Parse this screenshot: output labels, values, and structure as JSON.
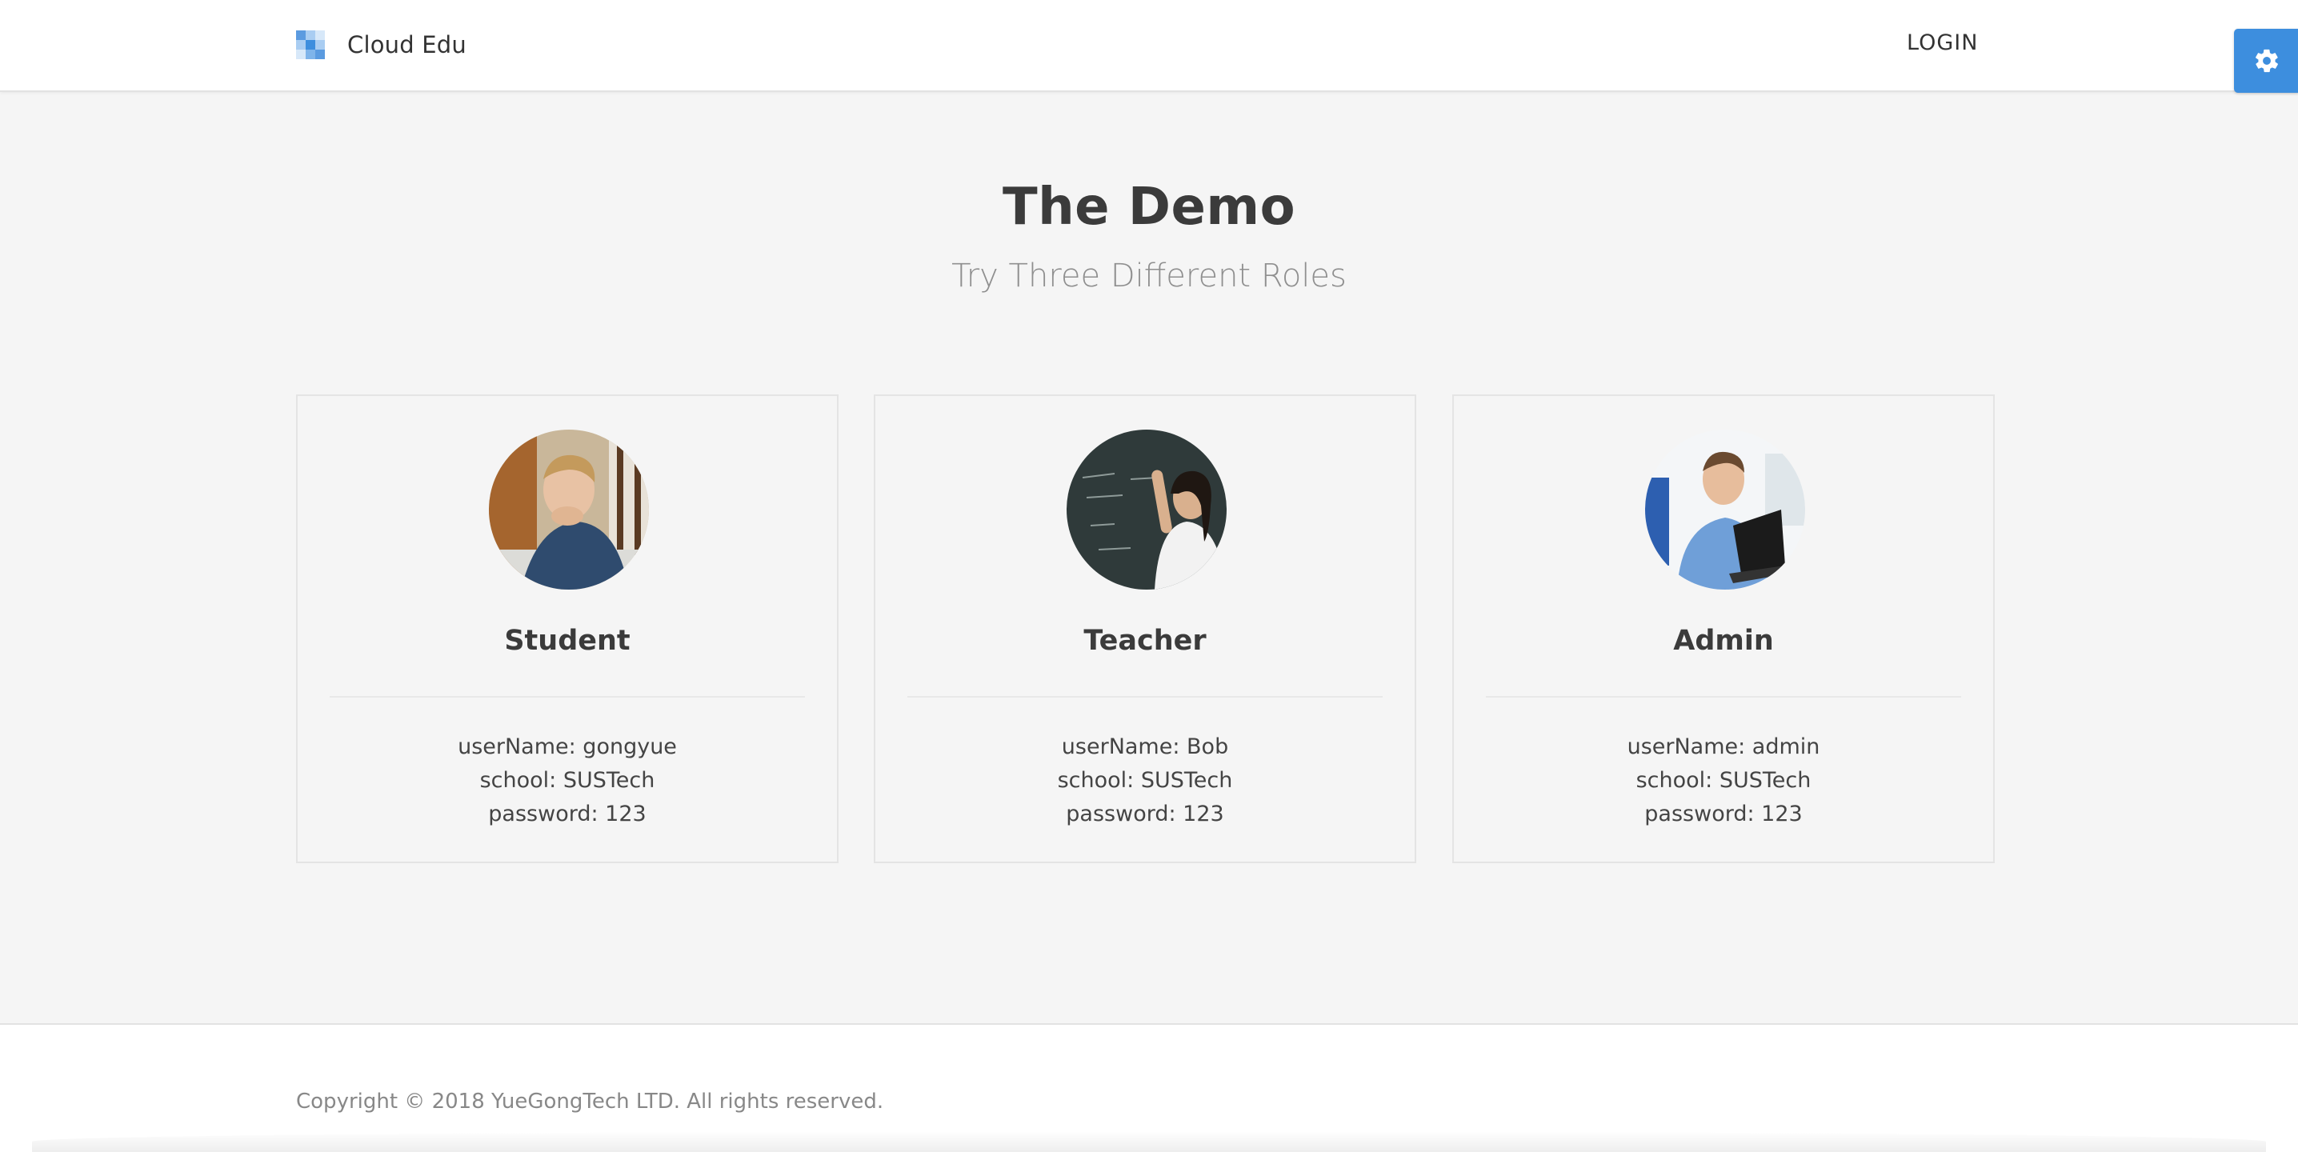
{
  "header": {
    "brand_name": "Cloud Edu",
    "login_label": "LOGIN",
    "settings_icon": "gear-icon",
    "accent_color": "#3d8ede"
  },
  "hero": {
    "title": "The Demo",
    "subtitle": "Try Three Different Roles"
  },
  "cards": [
    {
      "role": "Student",
      "avatar_icon": "student-avatar",
      "username": "userName: gongyue",
      "school": "school: SUSTech",
      "password": "password: 123"
    },
    {
      "role": "Teacher",
      "avatar_icon": "teacher-avatar",
      "username": "userName: Bob",
      "school": "school: SUSTech",
      "password": "password: 123"
    },
    {
      "role": "Admin",
      "avatar_icon": "admin-avatar",
      "username": "userName: admin",
      "school": "school: SUSTech",
      "password": "password: 123"
    }
  ],
  "footer": {
    "copyright": "Copyright © 2018 YueGongTech LTD. All rights reserved."
  }
}
